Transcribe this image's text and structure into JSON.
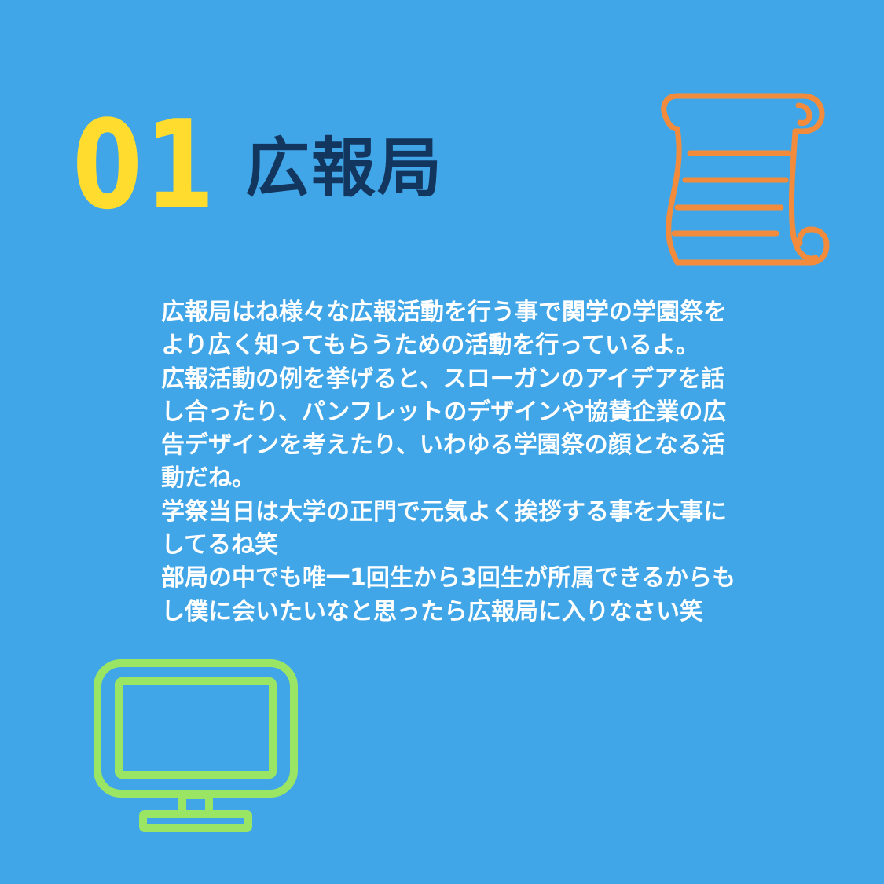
{
  "header": {
    "number": "01",
    "title": "広報局"
  },
  "body": {
    "lines": [
      "広報局はね様々な広報活動を行う事で関学の学園祭を",
      "より広く知ってもらうための活動を行っているよ。",
      "広報活動の例を挙げると、スローガンのアイデアを話",
      "し合ったり、パンフレットのデザインや協賛企業の広",
      "告デザインを考えたり、いわゆる学園祭の顔となる活",
      "動だね。",
      "学祭当日は大学の正門で元気よく挨拶する事を大事に",
      "してるね笑",
      "部局の中でも唯一1回生から3回生が所属できるからも",
      "し僕に会いたいなと思ったら広報局に入りなさい笑"
    ]
  },
  "icons": {
    "top_right": "scroll-icon",
    "bottom_left": "monitor-icon"
  },
  "colors": {
    "background": "#41a6e8",
    "number": "#ffdc2e",
    "title": "#13365f",
    "body_text": "#ffffff",
    "scroll_icon": "#f28c3c",
    "monitor_icon": "#9be564"
  }
}
